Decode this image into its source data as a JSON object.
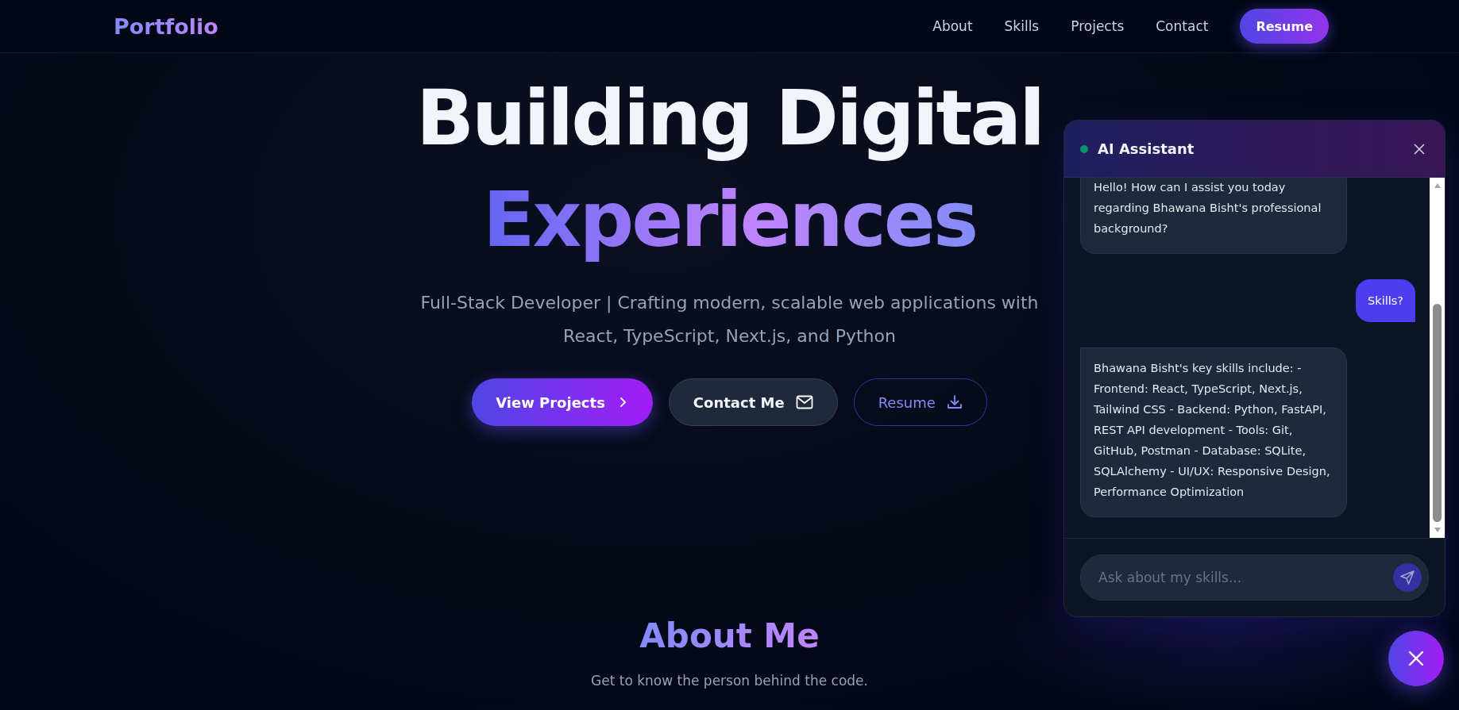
{
  "nav": {
    "logo": "Portfolio",
    "links": [
      "About",
      "Skills",
      "Projects",
      "Contact"
    ],
    "cta": "Resume"
  },
  "hero": {
    "title_line1": "Building Digital",
    "title_line2": "Experiences",
    "subtitle": "Full-Stack Developer | Crafting modern, scalable web applications with React, TypeScript, Next.js, and Python",
    "buttons": [
      {
        "label": "View Projects",
        "kind": "primary"
      },
      {
        "label": "Contact Me",
        "kind": "secondary"
      },
      {
        "label": "Resume",
        "kind": "outline"
      }
    ]
  },
  "about": {
    "title": "About Me",
    "subtitle": "Get to know the person behind the code."
  },
  "chat": {
    "title": "AI Assistant",
    "online": true,
    "messages": [
      {
        "kind": "bot",
        "text": "Hello! How can I assist you today regarding Bhawana Bisht's professional background?"
      },
      {
        "kind": "user",
        "text": "Skills?"
      },
      {
        "kind": "bot",
        "text": "Bhawana Bisht's key skills include: - Frontend: React, TypeScript, Next.js, Tailwind CSS - Backend: Python, FastAPI, REST API development - Tools: Git, GitHub, Postman - Database: SQLite, SQLAlchemy - UI/UX: Responsive Design, Performance Optimization"
      }
    ],
    "input": {
      "placeholder": "Ask about my skills..."
    }
  }
}
